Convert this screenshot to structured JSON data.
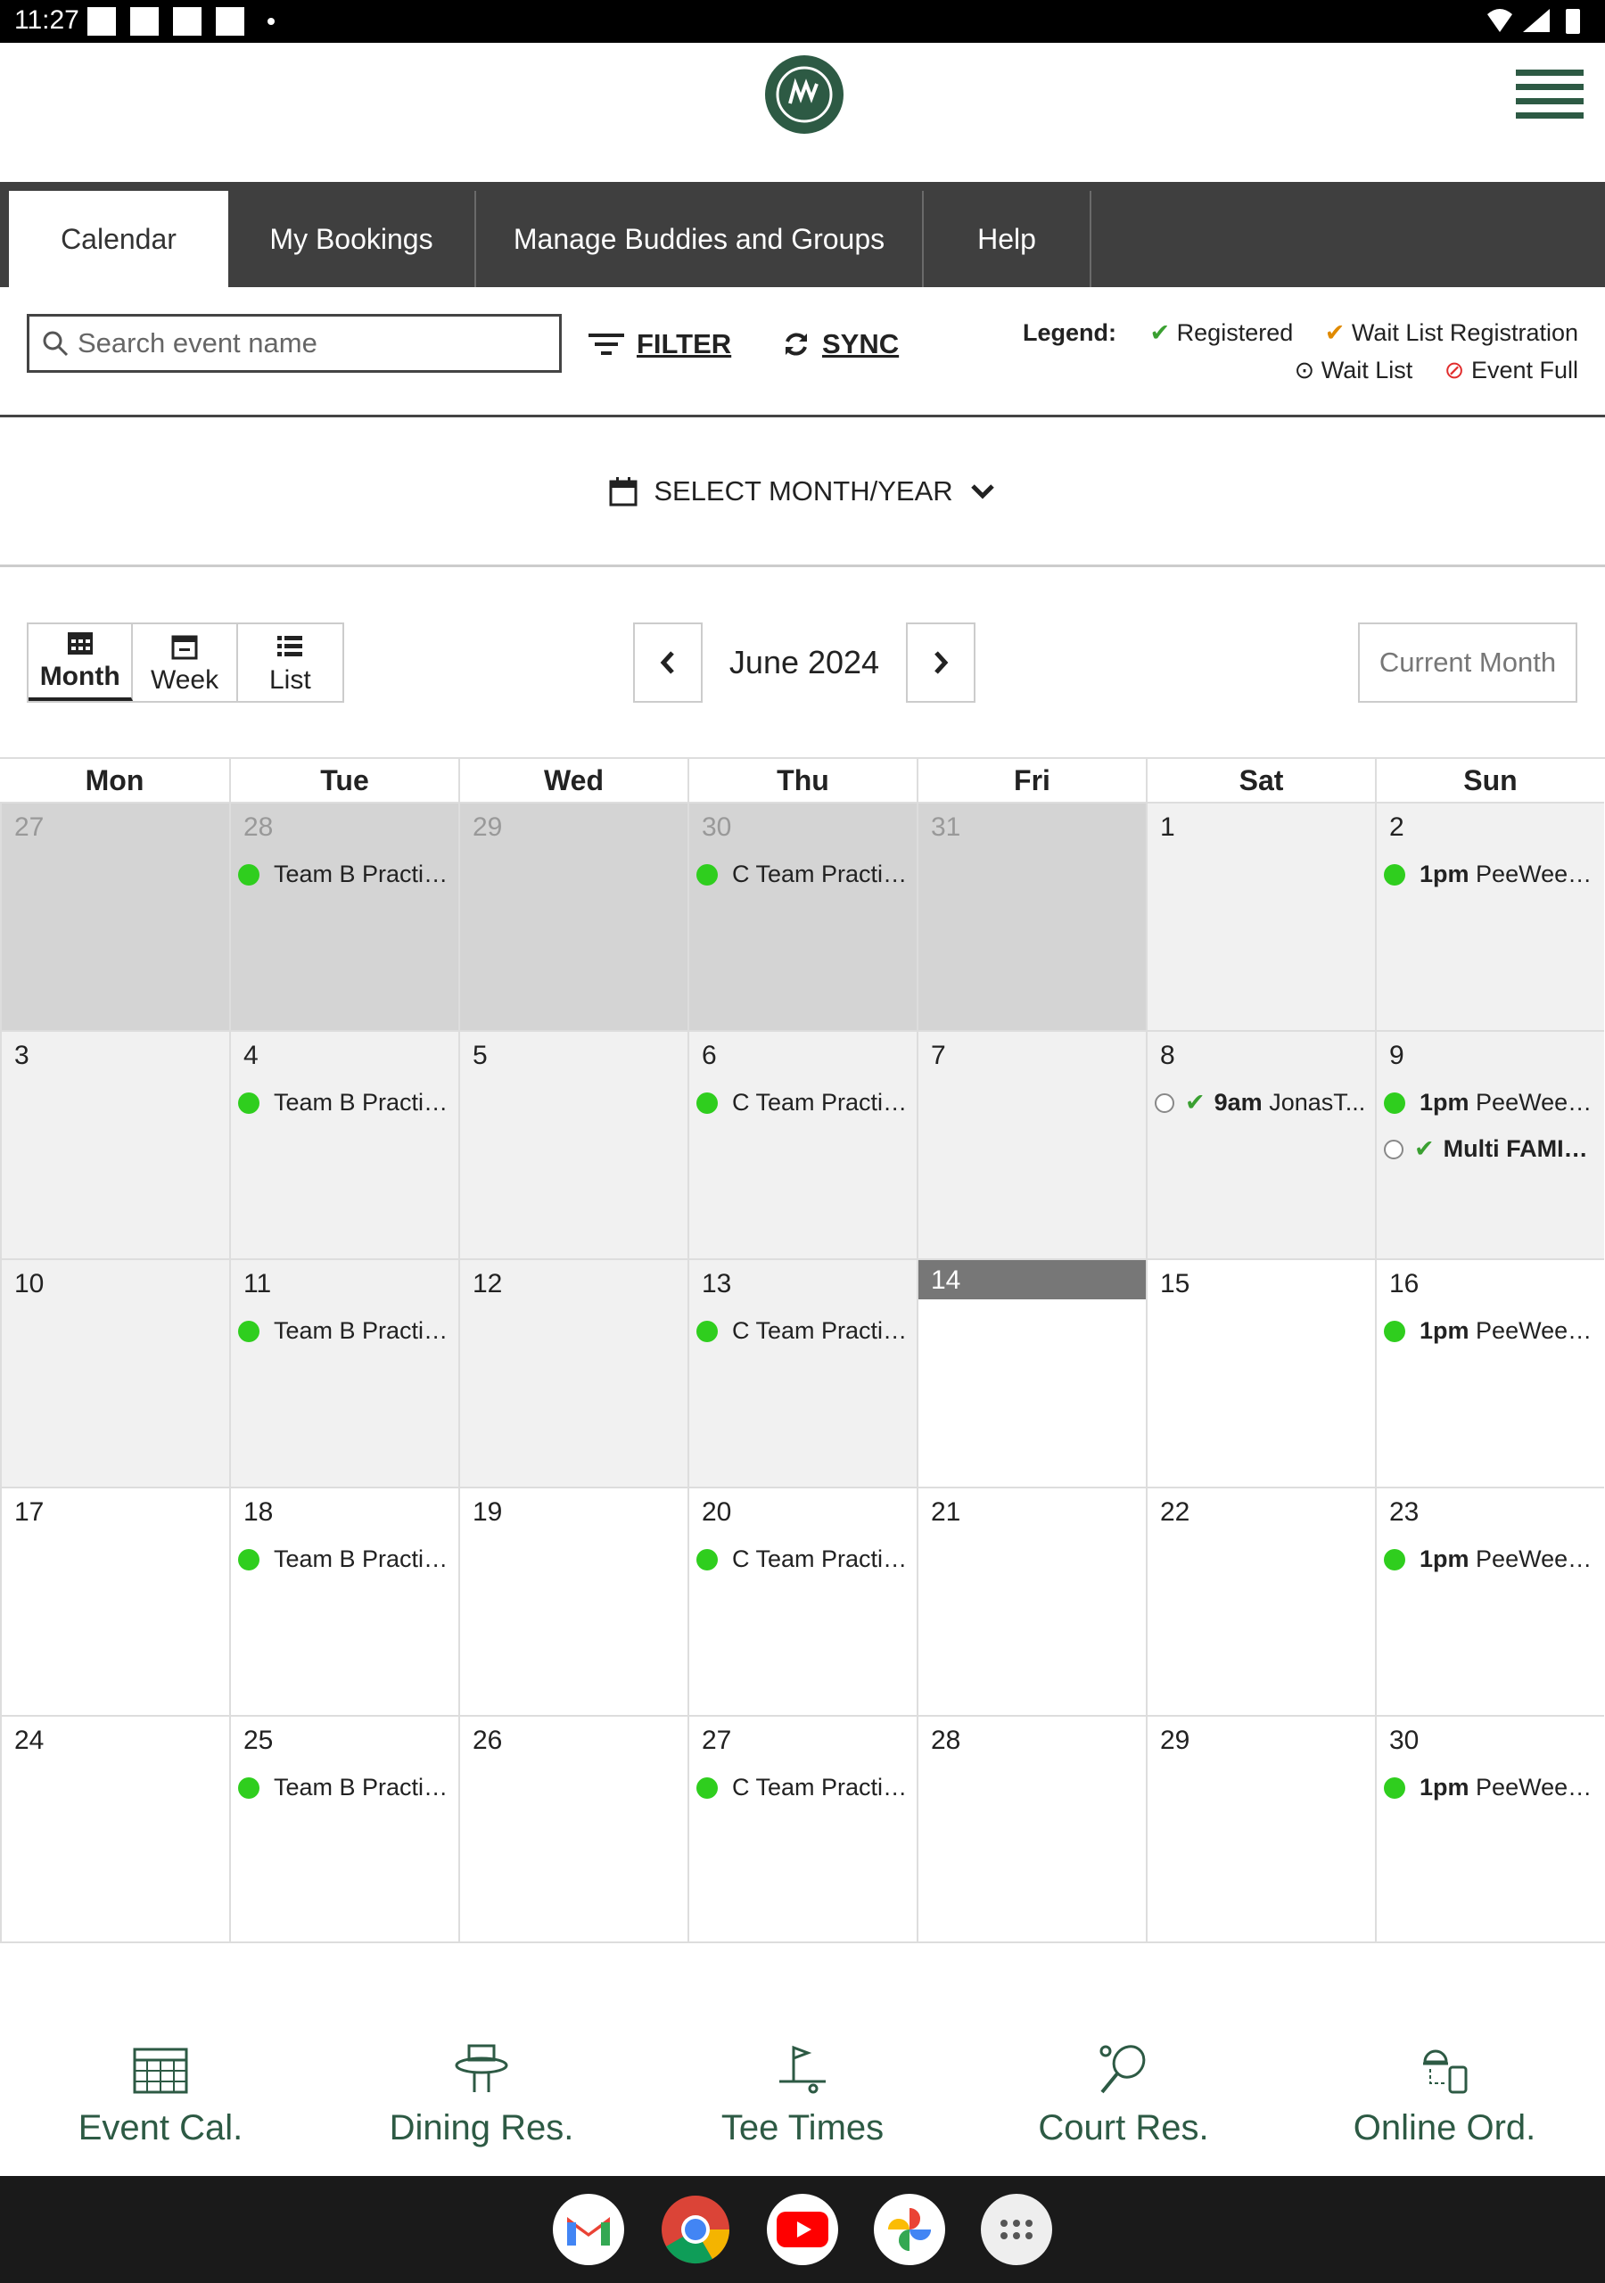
{
  "status": {
    "time": "11:27"
  },
  "tabs": [
    "Calendar",
    "My Bookings",
    "Manage Buddies and Groups",
    "Help"
  ],
  "search": {
    "placeholder": "Search event name"
  },
  "toolbar": {
    "filter": "FILTER",
    "sync": "SYNC"
  },
  "legend": {
    "title": "Legend:",
    "registered": "Registered",
    "waitlist_registration": "Wait List Registration",
    "waitlist": "Wait List",
    "event_full": "Event Full"
  },
  "select_month": "SELECT MONTH/YEAR",
  "views": {
    "month": "Month",
    "week": "Week",
    "list": "List"
  },
  "month_label": "June 2024",
  "current_month": "Current Month",
  "weekdays": [
    "Mon",
    "Tue",
    "Wed",
    "Thu",
    "Fri",
    "Sat",
    "Sun"
  ],
  "events": {
    "tue": "Team B Practic...",
    "thu": "C Team Practic...",
    "sun_time": "1pm",
    "sun_name": "PeeWee Cl...",
    "sat8_time": "9am",
    "sat8_name": "JonasT...",
    "sun9_multi": "Multi",
    "sun9_multi_name": "FAMIL..."
  },
  "bottom_nav": [
    "Event Cal.",
    "Dining Res.",
    "Tee Times",
    "Court Res.",
    "Online Ord."
  ],
  "colors": {
    "brand_green": "#2d5a44",
    "tab_bar": "#3f3f3f",
    "event_dot": "#2fce1e"
  }
}
